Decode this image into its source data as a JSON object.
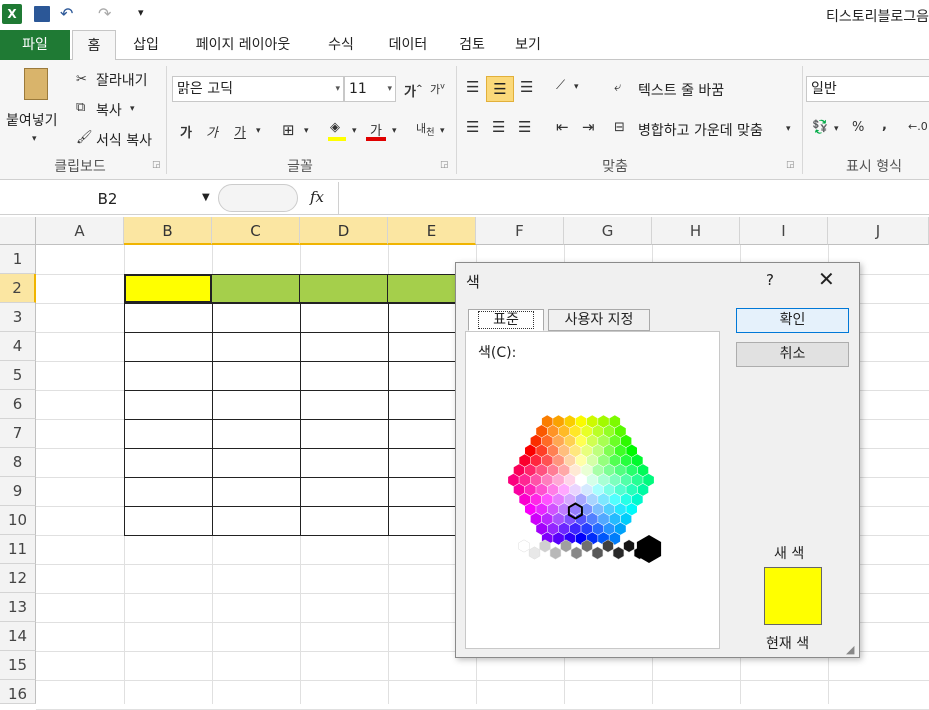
{
  "window": {
    "title": "티스토리블로그음"
  },
  "tabs": [
    {
      "label": "파일"
    },
    {
      "label": "홈"
    },
    {
      "label": "삽입"
    },
    {
      "label": "페이지 레이아웃"
    },
    {
      "label": "수식"
    },
    {
      "label": "데이터"
    },
    {
      "label": "검토"
    },
    {
      "label": "보기"
    }
  ],
  "ribbon": {
    "clipboard": {
      "label": "클립보드",
      "paste": "붙여넣기",
      "cut": "잘라내기",
      "copy": "복사",
      "format_painter": "서식 복사"
    },
    "font": {
      "label": "글꼴",
      "name": "맑은 고딕",
      "size": "11",
      "bold": "가",
      "italic": "가",
      "underline": "가"
    },
    "align": {
      "label": "맞춤",
      "wrap": "텍스트 줄 바꿈",
      "merge": "병합하고 가운데 맞춤"
    },
    "number": {
      "label": "표시 형식",
      "format": "일반",
      "percent": "%",
      "comma": ","
    }
  },
  "formula": {
    "namebox": "B2",
    "fx": "fx"
  },
  "columns": [
    "A",
    "B",
    "C",
    "D",
    "E",
    "F",
    "G",
    "H",
    "I",
    "J"
  ],
  "rows": [
    "1",
    "2",
    "3",
    "4",
    "5",
    "6",
    "7",
    "8",
    "9",
    "10",
    "11",
    "12",
    "13",
    "14",
    "15",
    "16"
  ],
  "colors": {
    "yellow": "#ffff00",
    "green": "#a5cf4b"
  },
  "dialog": {
    "title": "색",
    "help": "?",
    "close": "✕",
    "tab_standard": "표준",
    "tab_custom": "사용자 지정",
    "colors_label": "색(C):",
    "ok": "확인",
    "cancel": "취소",
    "new_label": "새 색",
    "current_label": "현재 색"
  }
}
